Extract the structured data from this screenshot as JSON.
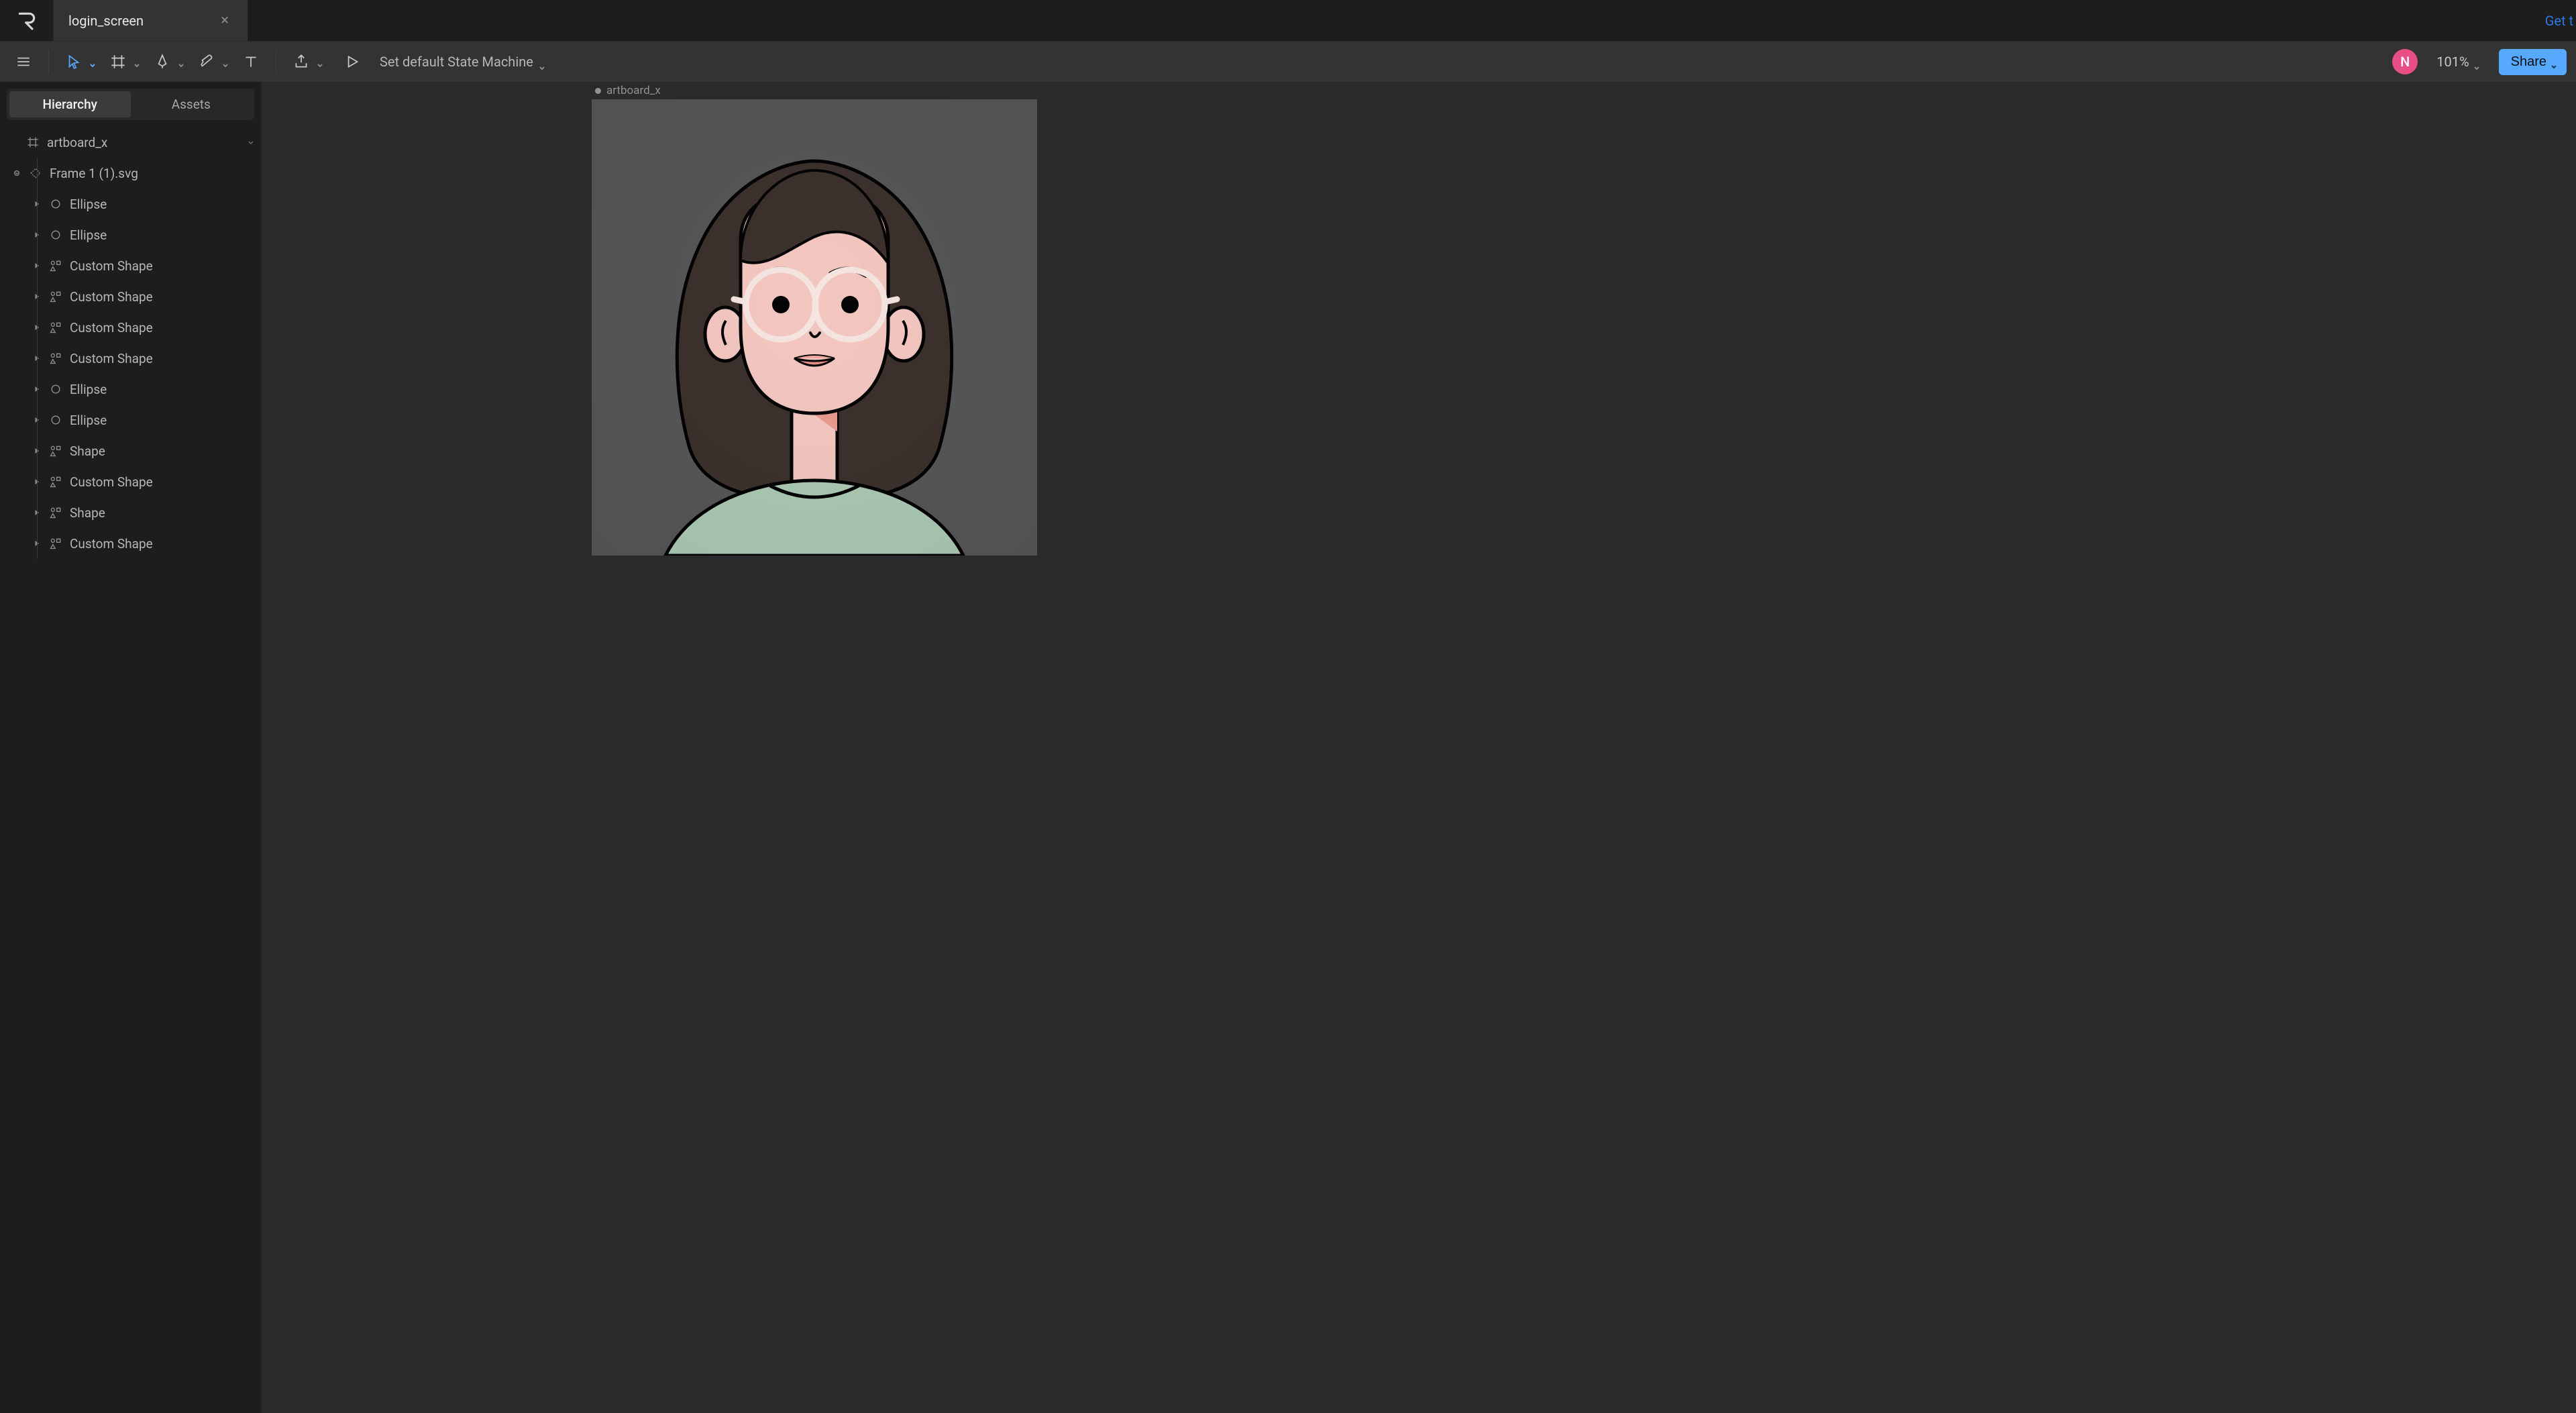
{
  "titlebar": {
    "tab_title": "login_screen",
    "right_link": "Get t"
  },
  "toolbar": {
    "state_machine_label": "Set default State Machine",
    "avatar_initial": "N",
    "zoom_label": "101%",
    "share_label": "Share"
  },
  "left_panel": {
    "tabs": {
      "hierarchy": "Hierarchy",
      "assets": "Assets"
    },
    "tree": [
      {
        "depth": 0,
        "icon": "artboard",
        "label": "artboard_x",
        "caret": "none",
        "end_chevron": true
      },
      {
        "depth": 1,
        "icon": "frame",
        "label": "Frame 1 (1).svg",
        "caret": "open"
      },
      {
        "depth": 2,
        "icon": "ellipse",
        "label": "Ellipse",
        "caret": "closed"
      },
      {
        "depth": 2,
        "icon": "ellipse",
        "label": "Ellipse",
        "caret": "closed"
      },
      {
        "depth": 2,
        "icon": "custom",
        "label": "Custom Shape",
        "caret": "closed"
      },
      {
        "depth": 2,
        "icon": "custom",
        "label": "Custom Shape",
        "caret": "closed"
      },
      {
        "depth": 2,
        "icon": "custom",
        "label": "Custom Shape",
        "caret": "closed"
      },
      {
        "depth": 2,
        "icon": "custom",
        "label": "Custom Shape",
        "caret": "closed"
      },
      {
        "depth": 2,
        "icon": "ellipse",
        "label": "Ellipse",
        "caret": "closed"
      },
      {
        "depth": 2,
        "icon": "ellipse",
        "label": "Ellipse",
        "caret": "closed"
      },
      {
        "depth": 2,
        "icon": "custom",
        "label": "Shape",
        "caret": "closed"
      },
      {
        "depth": 2,
        "icon": "custom",
        "label": "Custom Shape",
        "caret": "closed"
      },
      {
        "depth": 2,
        "icon": "custom",
        "label": "Shape",
        "caret": "closed"
      },
      {
        "depth": 2,
        "icon": "custom",
        "label": "Custom Shape",
        "caret": "closed"
      }
    ]
  },
  "canvas": {
    "artboard_label": "artboard_x"
  }
}
